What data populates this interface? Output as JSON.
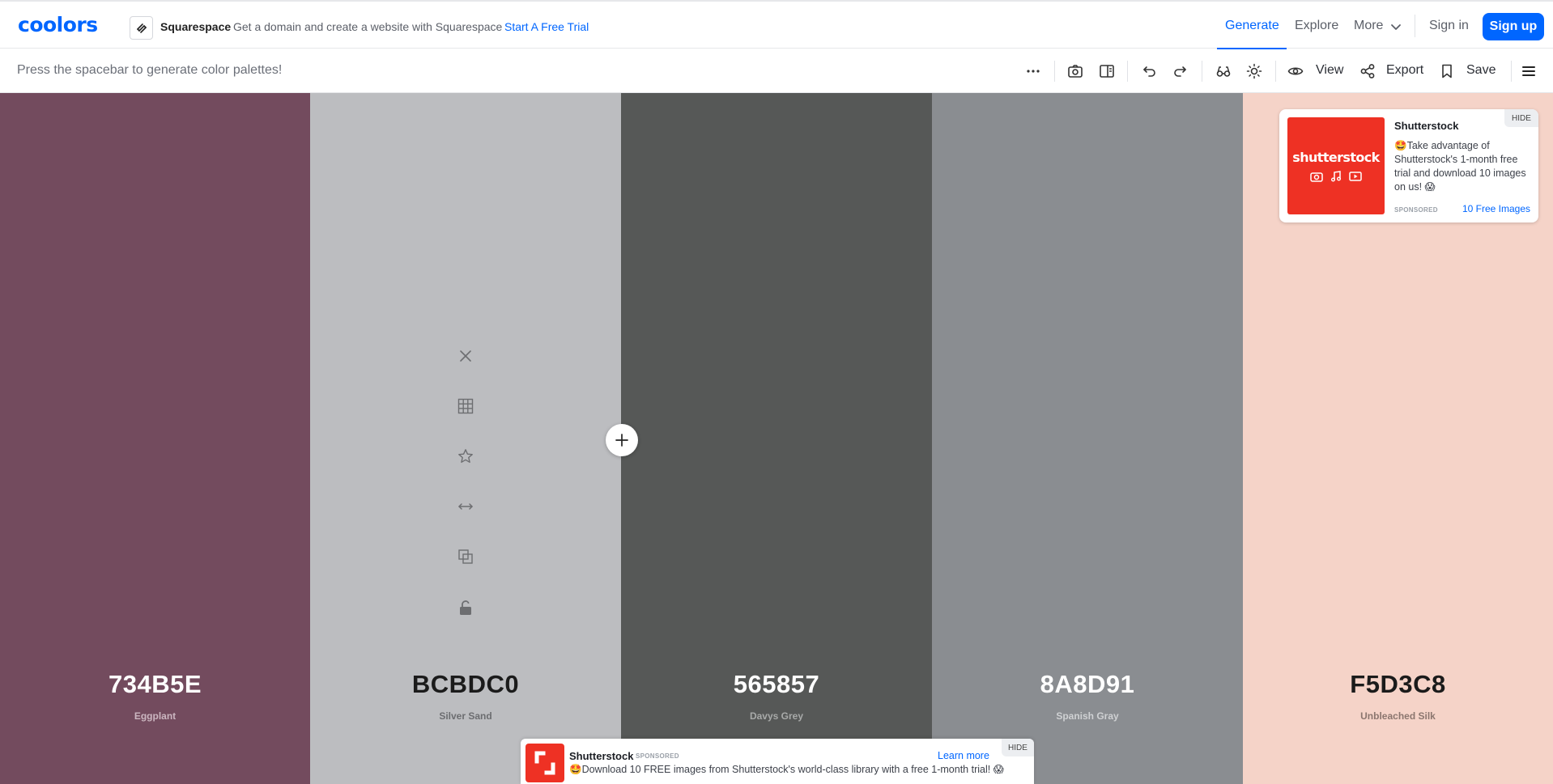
{
  "nav": {
    "logo": "coolors",
    "sponsor_name": "Squarespace",
    "sponsor_text": "Get a domain and create a website with Squarespace",
    "sponsor_cta": "Start A Free Trial",
    "links": {
      "generate": "Generate",
      "explore": "Explore",
      "more": "More"
    },
    "signin": "Sign in",
    "signup": "Sign up",
    "accent": "#0066ff"
  },
  "toolbar": {
    "hint": "Press the spacebar to generate color palettes!",
    "view_label": "View",
    "export_label": "Export",
    "save_label": "Save",
    "icons": [
      "more-dots-icon",
      "camera-icon",
      "panel-icon",
      "undo-icon",
      "redo-icon",
      "glasses-icon",
      "sun-icon",
      "eye-icon",
      "share-icon",
      "bookmark-icon",
      "menu-icon"
    ]
  },
  "palette": {
    "colors": [
      {
        "hex": "734B5E",
        "name": "Eggplant",
        "bg": "#734B5E",
        "hex_color": "#ffffff",
        "name_color": "#cbb6c0"
      },
      {
        "hex": "BCBDC0",
        "name": "Silver Sand",
        "bg": "#BCBDC0",
        "hex_color": "#1b1b1b",
        "name_color": "#6c6d70"
      },
      {
        "hex": "565857",
        "name": "Davys Grey",
        "bg": "#565857",
        "hex_color": "#ffffff",
        "name_color": "#a8aaa9"
      },
      {
        "hex": "8A8D91",
        "name": "Spanish Gray",
        "bg": "#8A8D91",
        "hex_color": "#ffffff",
        "name_color": "#cfd1d3"
      },
      {
        "hex": "F5D3C8",
        "name": "Unbleached Silk",
        "bg": "#F5D3C8",
        "hex_color": "#1b1b1b",
        "name_color": "#8b766f"
      }
    ],
    "hovered_tools": [
      "close-icon",
      "grid-icon",
      "star-icon",
      "drag-arrows-icon",
      "copy-icon",
      "unlock-icon"
    ]
  },
  "ad_card": {
    "image_text": "shutterstock",
    "title": "Shutterstock",
    "body": "🤩Take advantage of Shutterstock's 1-month free trial and download 10 images on us! 😱",
    "sponsored": "SPONSORED",
    "link": "10 Free Images",
    "hide": "HIDE",
    "brand_color": "#ee3124"
  },
  "banner": {
    "title": "Shutterstock",
    "sponsored": "SPONSORED",
    "body": "🤩Download 10 FREE images from Shutterstock's world-class library with a free 1-month trial! 😱",
    "learn_more": "Learn more",
    "hide": "HIDE"
  }
}
